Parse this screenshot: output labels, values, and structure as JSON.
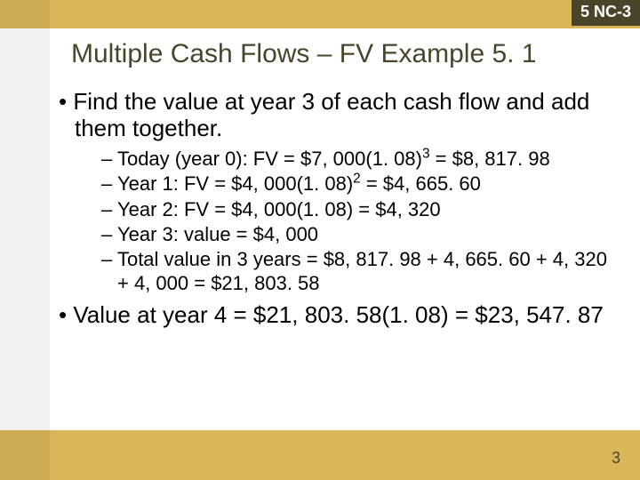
{
  "slide_tag": "5 NC-3",
  "title": "Multiple Cash Flows – FV Example 5. 1",
  "bullets": [
    {
      "text": "Find the value at year 3 of each cash flow and add them together.",
      "sub": [
        {
          "pre": "Today (year 0): FV = $7, 000(1. 08)",
          "exp": "3",
          "post": " = $8, 817. 98"
        },
        {
          "pre": "Year 1: FV = $4, 000(1. 08)",
          "exp": "2",
          "post": " = $4, 665. 60"
        },
        {
          "pre": "Year 2: FV = $4, 000(1. 08) = $4, 320",
          "exp": "",
          "post": ""
        },
        {
          "pre": "Year 3: value = $4, 000",
          "exp": "",
          "post": ""
        },
        {
          "pre": "Total value in 3 years = $8, 817. 98 + 4, 665. 60 + 4, 320 + 4, 000 = $21, 803. 58",
          "exp": "",
          "post": ""
        }
      ]
    },
    {
      "text": "Value at year 4 = $21, 803. 58(1. 08) = $23, 547. 87",
      "sub": []
    }
  ],
  "page_number": "3"
}
